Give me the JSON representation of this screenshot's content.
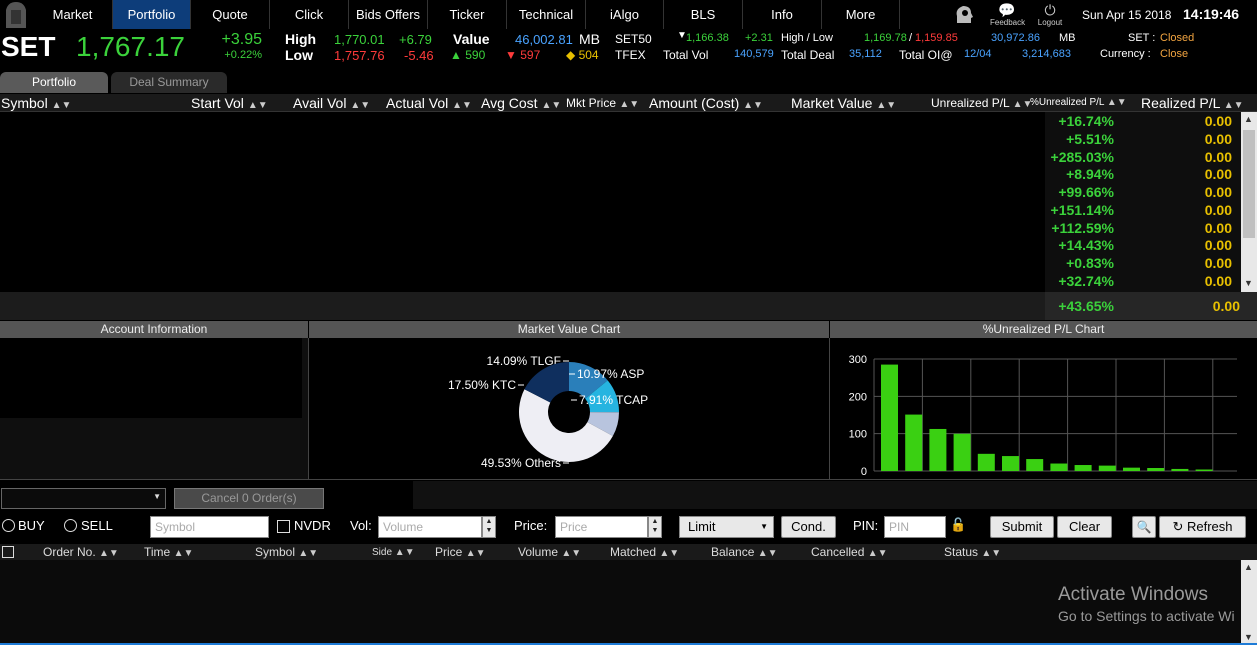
{
  "nav": {
    "items": [
      "Market",
      "Portfolio",
      "Quote",
      "Click",
      "Bids Offers",
      "Ticker",
      "Technical",
      "iAlgo",
      "BLS",
      "Info",
      "More"
    ],
    "active": "Portfolio",
    "feedback": "Feedback",
    "logout": "Logout",
    "date": "Sun Apr 15 2018",
    "time": "14:19:46"
  },
  "index": {
    "name": "SET",
    "value": "1,767.17",
    "change": "+3.95",
    "change_pct": "+0.22%",
    "high_label": "High",
    "low_label": "Low",
    "high": "1,770.01",
    "high_chg": "+6.79",
    "low": "1,757.76",
    "low_chg": "-5.46",
    "value_label": "Value",
    "value_amt": "46,002.81",
    "value_unit": "MB",
    "up": "590",
    "down": "597",
    "unch": "504",
    "set50_label": "SET50",
    "set50": "1,166.38",
    "set50_chg": "+2.31",
    "set50_hl_label": "High / Low",
    "set50_high": "1,169.78",
    "set50_low": "1,159.85",
    "set50_vol": "30,972.86",
    "set50_unit": "MB",
    "set_status_label": "SET :",
    "set_status": "Closed",
    "tfex_label": "TFEX",
    "total_vol_label": "Total Vol",
    "total_vol": "140,579",
    "total_deal_label": "Total Deal",
    "total_deal": "35,112",
    "total_oi_label": "Total OI@",
    "total_oi_date": "12/04",
    "total_oi": "3,214,683",
    "currency_label": "Currency :",
    "currency": "Close"
  },
  "tabs": [
    "Portfolio",
    "Deal Summary"
  ],
  "columns": [
    "Symbol",
    "Start Vol",
    "Avail Vol",
    "Actual Vol",
    "Avg Cost",
    "Mkt Price",
    "Amount (Cost)",
    "Market Value",
    "Unrealized P/L",
    "%Unrealized P/L",
    "Realized P/L"
  ],
  "rows": [
    {
      "pct": "+16.74%",
      "rpl": "0.00"
    },
    {
      "pct": "+5.51%",
      "rpl": "0.00"
    },
    {
      "pct": "+285.03%",
      "rpl": "0.00"
    },
    {
      "pct": "+8.94%",
      "rpl": "0.00"
    },
    {
      "pct": "+99.66%",
      "rpl": "0.00"
    },
    {
      "pct": "+151.14%",
      "rpl": "0.00"
    },
    {
      "pct": "+112.59%",
      "rpl": "0.00"
    },
    {
      "pct": "+14.43%",
      "rpl": "0.00"
    },
    {
      "pct": "+0.83%",
      "rpl": "0.00"
    },
    {
      "pct": "+32.74%",
      "rpl": "0.00"
    }
  ],
  "summary": {
    "pct": "+43.65%",
    "rpl": "0.00"
  },
  "sections": {
    "account": "Account Information",
    "mv_chart": "Market Value Chart",
    "upl_chart": "%Unrealized P/L Chart"
  },
  "chart_data": [
    {
      "type": "pie",
      "title": "Market Value Chart",
      "slices": [
        {
          "label": "TLGF",
          "value": 14.09,
          "color": "#2a7fba"
        },
        {
          "label": "ASP",
          "value": 10.97,
          "color": "#26b4e0"
        },
        {
          "label": "TCAP",
          "value": 7.91,
          "color": "#b8c4de"
        },
        {
          "label": "Others",
          "value": 49.53,
          "color": "#eeeef4"
        },
        {
          "label": "KTC",
          "value": 17.5,
          "color": "#0f2f5e"
        }
      ]
    },
    {
      "type": "bar",
      "title": "%Unrealized P/L Chart",
      "values": [
        285.03,
        151.14,
        112.59,
        99.66,
        46,
        40,
        32,
        20,
        16,
        14.43,
        8.94,
        8,
        5.51,
        4
      ],
      "ylim": [
        0,
        300
      ],
      "yticks": [
        "300",
        "200",
        "100",
        "0"
      ],
      "color": "#3ad012"
    }
  ],
  "order": {
    "cancel_btn": "Cancel 0 Order(s)",
    "buy": "BUY",
    "sell": "SELL",
    "symbol_ph": "Symbol",
    "nvdr": "NVDR",
    "vol_label": "Vol:",
    "vol_ph": "Volume",
    "price_label": "Price:",
    "price_ph": "Price",
    "type": "Limit",
    "cond": "Cond.",
    "pin_label": "PIN:",
    "pin_ph": "PIN",
    "submit": "Submit",
    "clear": "Clear",
    "refresh": "Refresh"
  },
  "order_columns": [
    "Order No.",
    "Time",
    "Symbol",
    "Side",
    "Price",
    "Volume",
    "Matched",
    "Balance",
    "Cancelled",
    "Status"
  ],
  "watermark": {
    "line1": "Activate Windows",
    "line2": "Go to Settings to activate Wi"
  }
}
